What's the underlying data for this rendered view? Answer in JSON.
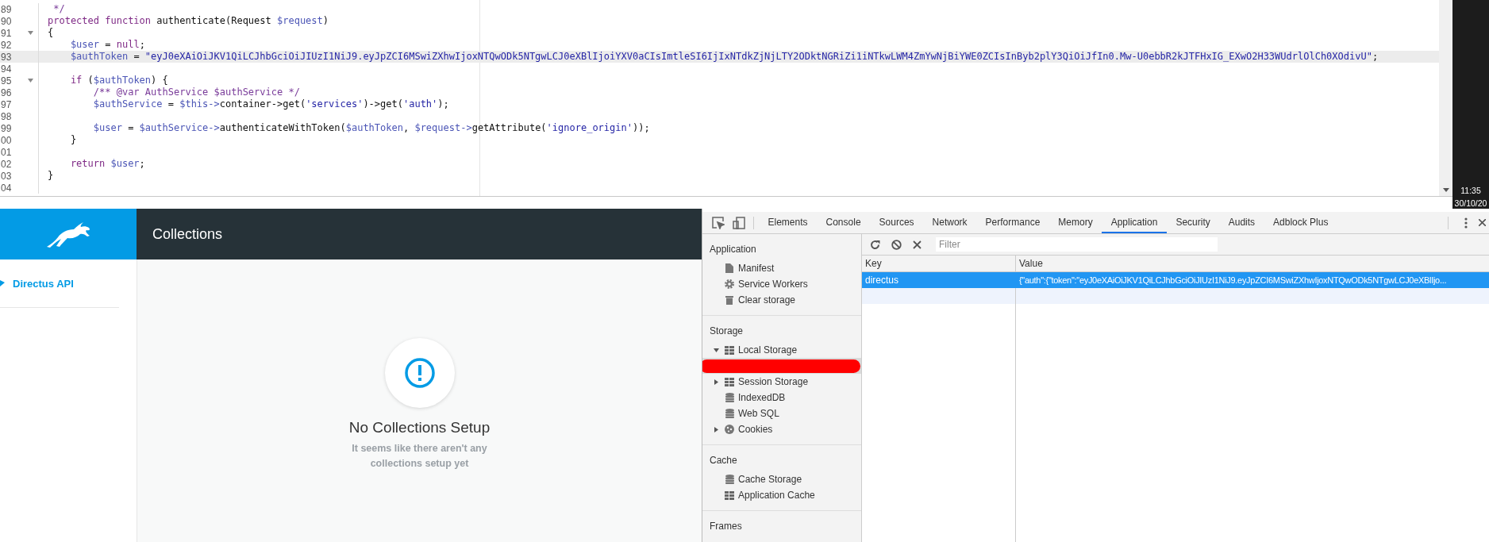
{
  "editor": {
    "lines": [
      {
        "number": "89",
        "foldable": false,
        "current": false,
        "tokens": [
          {
            "kind": "comment",
            "text": " */"
          }
        ]
      },
      {
        "number": "90",
        "foldable": false,
        "current": false,
        "tokens": [
          {
            "kind": "keyword",
            "text": "protected function"
          },
          {
            "kind": "plain",
            "text": " authenticate(Request "
          },
          {
            "kind": "variable",
            "text": "$request"
          },
          {
            "kind": "plain",
            "text": ")"
          }
        ]
      },
      {
        "number": "91",
        "foldable": true,
        "current": false,
        "tokens": [
          {
            "kind": "plain",
            "text": "{"
          }
        ]
      },
      {
        "number": "92",
        "foldable": false,
        "current": false,
        "tokens": [
          {
            "kind": "variable",
            "text": "    $user"
          },
          {
            "kind": "plain",
            "text": " = "
          },
          {
            "kind": "keyword",
            "text": "null"
          },
          {
            "kind": "plain",
            "text": ";"
          }
        ]
      },
      {
        "number": "93",
        "foldable": false,
        "current": true,
        "tokens": [
          {
            "kind": "variable",
            "text": "    $authToken"
          },
          {
            "kind": "plain",
            "text": " = "
          },
          {
            "kind": "string",
            "text": "\"eyJ0eXAiOiJKV1QiLCJhbGciOiJIUzI1NiJ9.eyJpZCI6MSwiZXhwIjoxNTQwODk5NTgwLCJ0eXBlIjoiYXV0aCIsImtleSI6IjIxNTdkZjNjLTY2ODktNGRiZi1iNTkwLWM4ZmYwNjBiYWE0ZCIsInByb2plY3QiOiJfIn0.Mw-U0ebbR2kJTFHxIG_EXwO2H33WUdrlOlCh0XOdivU\""
          },
          {
            "kind": "plain",
            "text": ";"
          }
        ]
      },
      {
        "number": "94",
        "foldable": false,
        "current": false
      },
      {
        "number": "95",
        "foldable": true,
        "current": false,
        "tokens": [
          {
            "kind": "keyword",
            "text": "    if"
          },
          {
            "kind": "plain",
            "text": " ("
          },
          {
            "kind": "variable",
            "text": "$authToken"
          },
          {
            "kind": "plain",
            "text": ") {"
          }
        ]
      },
      {
        "number": "96",
        "foldable": false,
        "current": false,
        "tokens": [
          {
            "kind": "comment",
            "text": "        /** @var AuthService $authService */"
          }
        ]
      },
      {
        "number": "97",
        "foldable": false,
        "current": false,
        "tokens": [
          {
            "kind": "variable",
            "text": "        $authService"
          },
          {
            "kind": "plain",
            "text": " = "
          },
          {
            "kind": "variable",
            "text": "$this->"
          },
          {
            "kind": "plain",
            "text": "container->get("
          },
          {
            "kind": "string",
            "text": "'services'"
          },
          {
            "kind": "plain",
            "text": ")->get("
          },
          {
            "kind": "string",
            "text": "'auth'"
          },
          {
            "kind": "plain",
            "text": ");"
          }
        ]
      },
      {
        "number": "98",
        "foldable": false,
        "current": false
      },
      {
        "number": "99",
        "foldable": false,
        "current": false,
        "tokens": [
          {
            "kind": "variable",
            "text": "        $user"
          },
          {
            "kind": "plain",
            "text": " = "
          },
          {
            "kind": "variable",
            "text": "$authService->"
          },
          {
            "kind": "plain",
            "text": "authenticateWithToken("
          },
          {
            "kind": "variable",
            "text": "$authToken"
          },
          {
            "kind": "plain",
            "text": ", "
          },
          {
            "kind": "variable",
            "text": "$request->"
          },
          {
            "kind": "plain",
            "text": "getAttribute("
          },
          {
            "kind": "string",
            "text": "'ignore_origin'"
          },
          {
            "kind": "plain",
            "text": "));"
          }
        ]
      },
      {
        "number": "00",
        "foldable": false,
        "current": false,
        "tokens": [
          {
            "kind": "plain",
            "text": "    }"
          }
        ]
      },
      {
        "number": "01",
        "foldable": false,
        "current": false
      },
      {
        "number": "02",
        "foldable": false,
        "current": false,
        "tokens": [
          {
            "kind": "keyword",
            "text": "    return"
          },
          {
            "kind": "variable",
            "text": " $user"
          },
          {
            "kind": "plain",
            "text": ";"
          }
        ]
      },
      {
        "number": "03",
        "foldable": false,
        "current": false,
        "tokens": [
          {
            "kind": "plain",
            "text": "}"
          }
        ]
      },
      {
        "number": "04",
        "foldable": false,
        "current": false
      }
    ]
  },
  "taskbar": {
    "time": "11:35",
    "date": "30/10/20"
  },
  "app": {
    "header_title": "Collections",
    "project": "Directus API",
    "empty_state": {
      "title": "No Collections Setup",
      "message": "It seems like there aren't any collections setup yet"
    }
  },
  "devtools": {
    "tabs": [
      {
        "label": "Elements",
        "selected": false
      },
      {
        "label": "Console",
        "selected": false
      },
      {
        "label": "Sources",
        "selected": false
      },
      {
        "label": "Network",
        "selected": false
      },
      {
        "label": "Performance",
        "selected": false
      },
      {
        "label": "Memory",
        "selected": false
      },
      {
        "label": "Application",
        "selected": true
      },
      {
        "label": "Security",
        "selected": false
      },
      {
        "label": "Audits",
        "selected": false
      },
      {
        "label": "Adblock Plus",
        "selected": false
      }
    ],
    "sidebar": [
      {
        "title": "Application",
        "items": [
          {
            "label": "Manifest",
            "kind": "file",
            "selected": false
          },
          {
            "label": "Service Workers",
            "kind": "gear",
            "selected": false
          },
          {
            "label": "Clear storage",
            "kind": "trash",
            "selected": false
          }
        ]
      },
      {
        "title": "Storage",
        "items": [
          {
            "label": "Local Storage",
            "kind": "grid",
            "selected": false,
            "expanded": true,
            "children": [
              {
                "kind": "redacted",
                "selected": true
              }
            ]
          },
          {
            "label": "Session Storage",
            "kind": "grid",
            "selected": false,
            "expanded": false
          },
          {
            "label": "IndexedDB",
            "kind": "database",
            "selected": false
          },
          {
            "label": "Web SQL",
            "kind": "database",
            "selected": false
          },
          {
            "label": "Cookies",
            "kind": "cookie",
            "selected": false,
            "expanded": false
          }
        ]
      },
      {
        "title": "Cache",
        "items": [
          {
            "label": "Cache Storage",
            "kind": "database",
            "selected": false
          },
          {
            "label": "Application Cache",
            "kind": "grid",
            "selected": false
          }
        ]
      },
      {
        "title": "Frames"
      }
    ],
    "filter": {
      "placeholder": "Filter"
    },
    "table": {
      "columns": [
        "Key",
        "Value"
      ],
      "rows": [
        {
          "key": "directus",
          "value": "{\"auth\":{\"token\":\"eyJ0eXAiOiJKV1QiLCJhbGciOiJIUzI1NiJ9.eyJpZCI6MSwiZXhwIjoxNTQwODk5NTgwLCJ0eXBlIjo...",
          "selected": true
        }
      ]
    }
  }
}
